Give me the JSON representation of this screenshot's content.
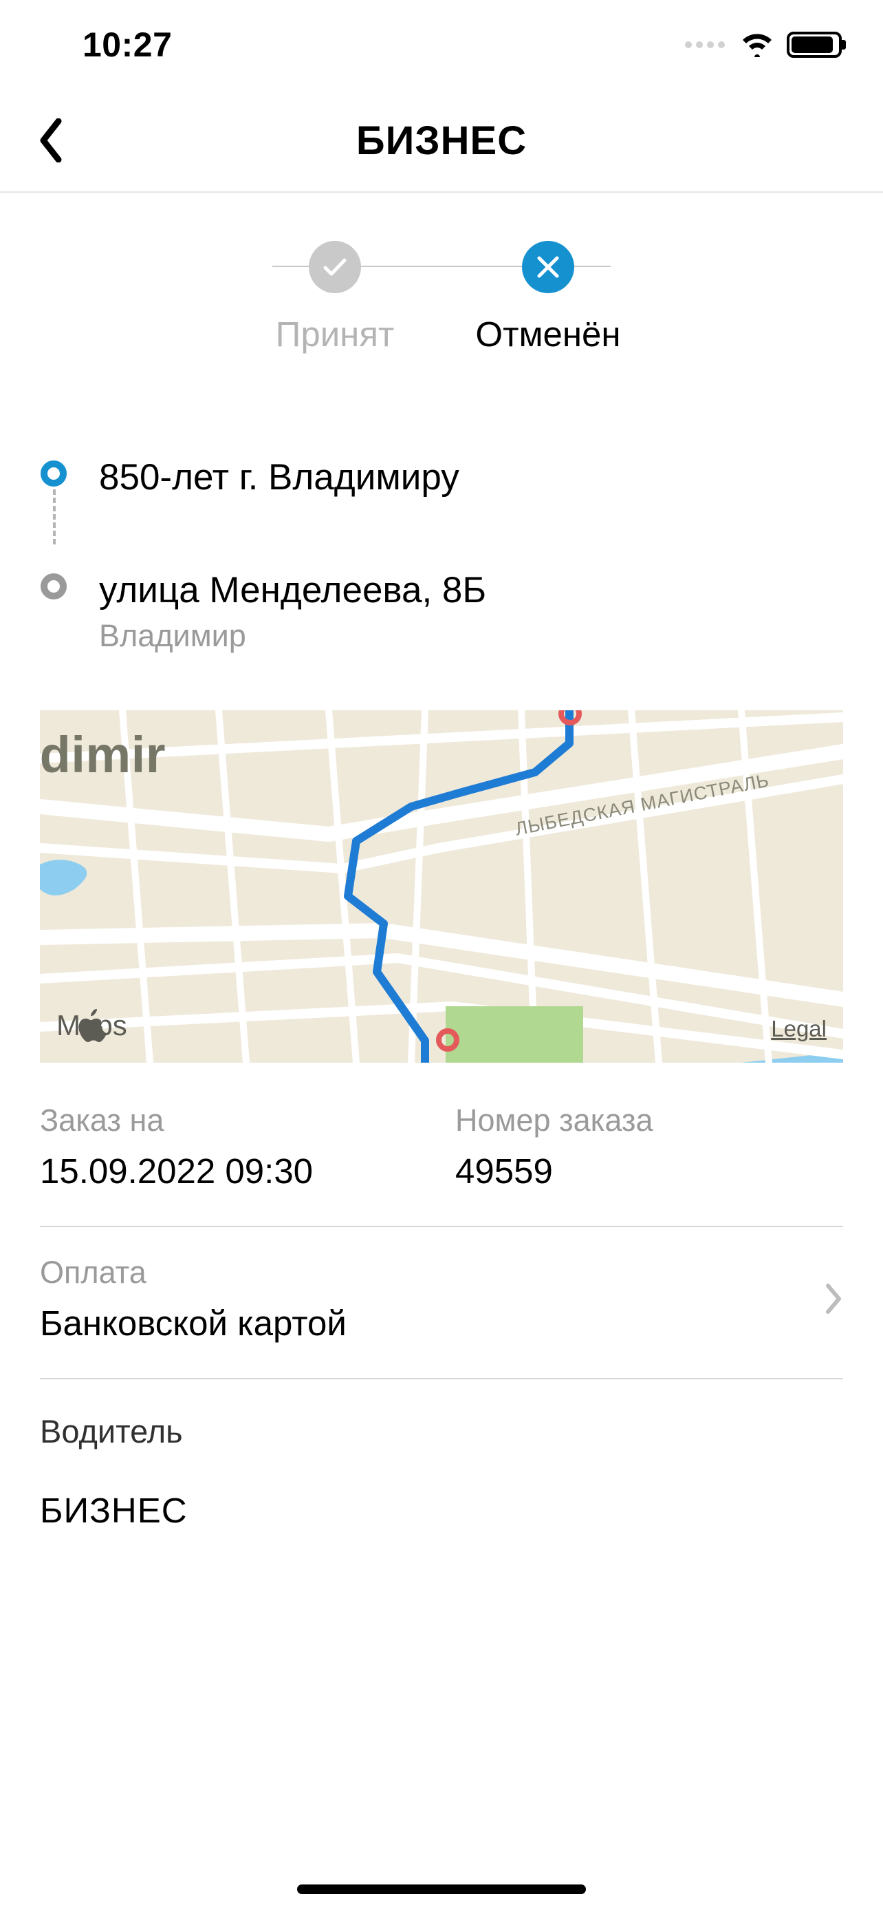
{
  "status_bar": {
    "time": "10:27"
  },
  "header": {
    "title": "БИЗНЕС"
  },
  "progress": {
    "step_accepted": "Принят",
    "step_cancelled": "Отменён"
  },
  "route": {
    "origin": {
      "address": "850-лет г. Владимиру"
    },
    "destination": {
      "address": "улица Менделеева, 8Б",
      "city": "Владимир"
    }
  },
  "map": {
    "city_label": "adimir",
    "road_label": "ЛЫБЕДСКАЯ МАГИСТРАЛЬ",
    "provider": "Maps",
    "legal": "Legal"
  },
  "details": {
    "order_for_label": "Заказ на",
    "order_for_value": "15.09.2022 09:30",
    "order_number_label": "Номер заказа",
    "order_number_value": "49559",
    "payment_label": "Оплата",
    "payment_value": "Банковской картой",
    "driver_label": "Водитель",
    "driver_value": "БИЗНЕС"
  }
}
